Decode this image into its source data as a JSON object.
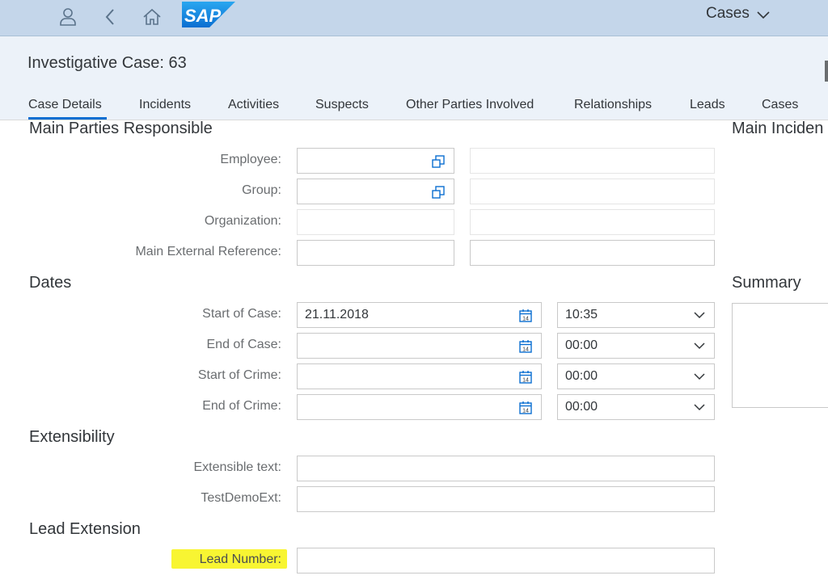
{
  "shell": {
    "app_title": "Cases",
    "logo_text": "SAP"
  },
  "header": {
    "title": "Investigative Case: 63"
  },
  "tabs": [
    {
      "label": "Case Details"
    },
    {
      "label": "Incidents"
    },
    {
      "label": "Activities"
    },
    {
      "label": "Suspects"
    },
    {
      "label": "Other Parties Involved"
    },
    {
      "label": "Relationships"
    },
    {
      "label": "Leads"
    },
    {
      "label": "Cases"
    }
  ],
  "main_parties": {
    "title": "Main Parties Responsible",
    "employee_label": "Employee:",
    "group_label": "Group:",
    "organization_label": "Organization:",
    "external_ref_label": "Main External Reference:"
  },
  "dates": {
    "title": "Dates",
    "start_case_label": "Start of Case:",
    "start_case_date": "21.11.2018",
    "start_case_time": "10:35",
    "end_case_label": "End of Case:",
    "end_case_time": "00:00",
    "start_crime_label": "Start of Crime:",
    "start_crime_time": "00:00",
    "end_crime_label": "End of Crime:",
    "end_crime_time": "00:00"
  },
  "extensibility": {
    "title": "Extensibility",
    "extensible_text_label": "Extensible text:",
    "testdemoext_label": "TestDemoExt:"
  },
  "lead_extension": {
    "title": "Lead Extension",
    "lead_number_label": "Lead Number:"
  },
  "right_column": {
    "main_incident_title": "Main Inciden",
    "summary_title": "Summary"
  },
  "colors": {
    "shell_bg": "#c4d6ea",
    "header_bg": "#ecf2f9",
    "accent": "#0a6ed1",
    "highlight": "#f8f532"
  }
}
